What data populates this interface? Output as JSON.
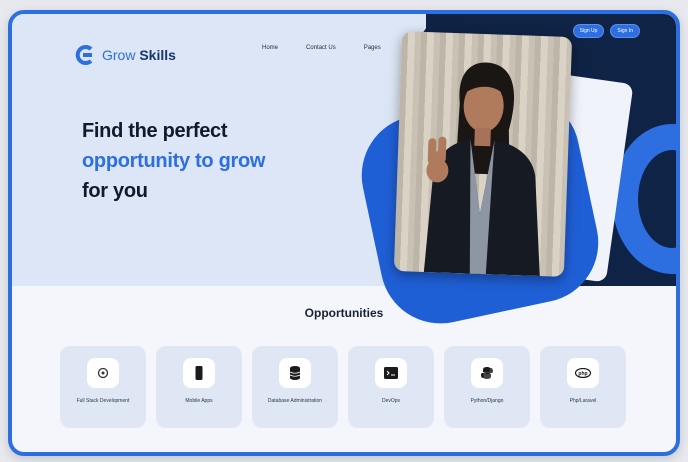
{
  "brand": {
    "name_part1": "Grow",
    "name_part2": "Skills",
    "accent": "#2d6fe0",
    "dark": "#0f2346"
  },
  "nav": {
    "items": [
      "Home",
      "Contact Us",
      "Pages"
    ]
  },
  "auth": {
    "signup": "Sign Up",
    "signin": "Sign In"
  },
  "hero": {
    "line1": "Find the perfect",
    "line2": "opportunity to grow",
    "line3": "for you"
  },
  "opportunities": {
    "title": "Opportunities",
    "items": [
      {
        "label": "Full Stack Development",
        "icon": "code-gear-icon"
      },
      {
        "label": "Mobile Apps",
        "icon": "phone-icon"
      },
      {
        "label": "Database Administration",
        "icon": "database-icon"
      },
      {
        "label": "DevOps",
        "icon": "devops-icon"
      },
      {
        "label": "Python/Django",
        "icon": "python-icon"
      },
      {
        "label": "Php/Laravel",
        "icon": "php-icon"
      }
    ]
  }
}
